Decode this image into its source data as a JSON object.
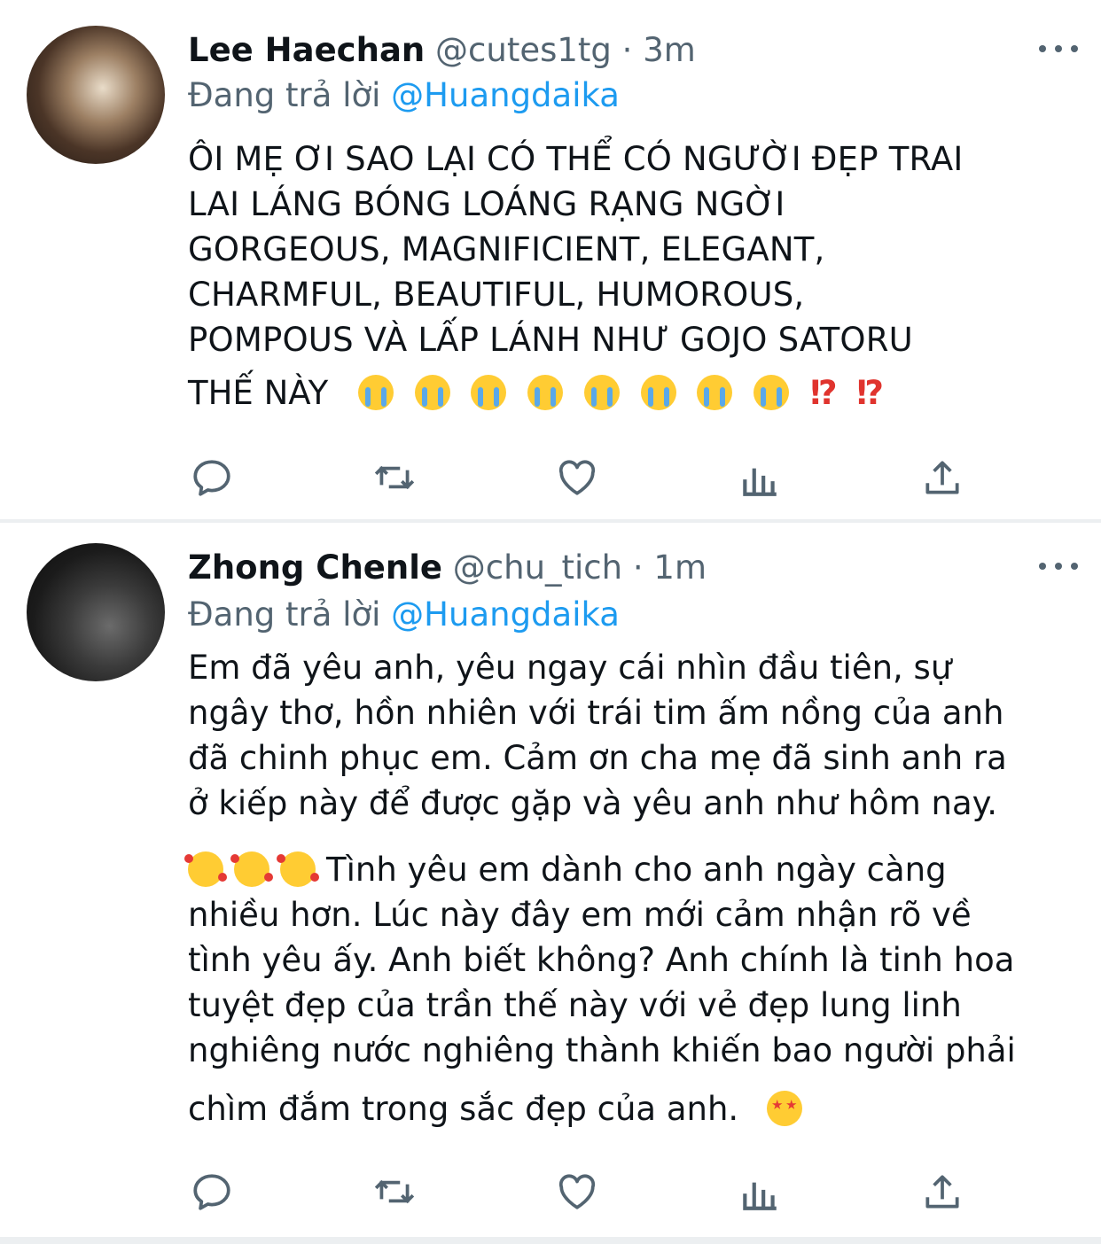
{
  "tweets": [
    {
      "name": "Lee Haechan",
      "handle": "@cutes1tg",
      "separator": "·",
      "time": "3m",
      "replying_prefix": "Đang trả lời",
      "replying_to": "@Huangdaika",
      "body_lines": [
        "ÔI MẸ ƠI SAO LẠI CÓ THỂ CÓ NGƯỜI ĐẸP TRAI",
        "LAI LÁNG BÓNG LOÁNG RẠNG NGỜI",
        "GORGEOUS, MAGNIFICIENT, ELEGANT,",
        "CHARMFUL, BEAUTIFUL, HUMOROUS,",
        "POMPOUS VÀ LẤP LÁNH NHƯ GOJO SATORU"
      ],
      "body_tail_text": "THẾ NÀY",
      "body_tail_emojis": [
        "loudly-crying-face",
        "loudly-crying-face",
        "loudly-crying-face",
        "loudly-crying-face",
        "loudly-crying-face",
        "loudly-crying-face",
        "loudly-crying-face",
        "loudly-crying-face"
      ],
      "body_tail_marks": [
        "⁉",
        "⁉"
      ],
      "actions": [
        "reply-icon",
        "retweet-icon",
        "like-icon",
        "analytics-icon",
        "share-icon"
      ]
    },
    {
      "name": "Zhong Chenle",
      "handle": "@chu_tich",
      "separator": "·",
      "time": "1m",
      "replying_prefix": "Đang trả lời",
      "replying_to": "@Huangdaika",
      "body_lines": [
        "Em đã yêu anh, yêu ngay cái nhìn đầu tiên, sự",
        "ngây thơ, hồn nhiên với trái tim ấm nồng của anh",
        "đã chinh phục em. Cảm ơn cha mẹ đã sinh anh ra",
        "ở kiếp này để được gặp và yêu anh như hôm nay."
      ],
      "para2_lead_emojis": [
        "smiling-face-with-hearts",
        "smiling-face-with-hearts",
        "smiling-face-with-hearts"
      ],
      "para2_lines": [
        "Tình yêu em dành cho anh ngày càng",
        "nhiều hơn. Lúc này đây em mới cảm nhận rõ về",
        "tình yêu ấy. Anh biết không? Anh chính là tinh hoa",
        "tuyệt đẹp của trần thế này với vẻ đẹp lung linh",
        "nghiêng nước nghiêng thành khiến bao người phải"
      ],
      "para3_text": "chìm đắm trong sắc đẹp của anh.",
      "para3_emoji": "star-struck",
      "actions": [
        "reply-icon",
        "retweet-icon",
        "like-icon",
        "analytics-icon",
        "share-icon"
      ]
    }
  ],
  "colors": {
    "text": "#0f1419",
    "secondary": "#536471",
    "link": "#1d9bf0",
    "divider": "#eceff1"
  }
}
